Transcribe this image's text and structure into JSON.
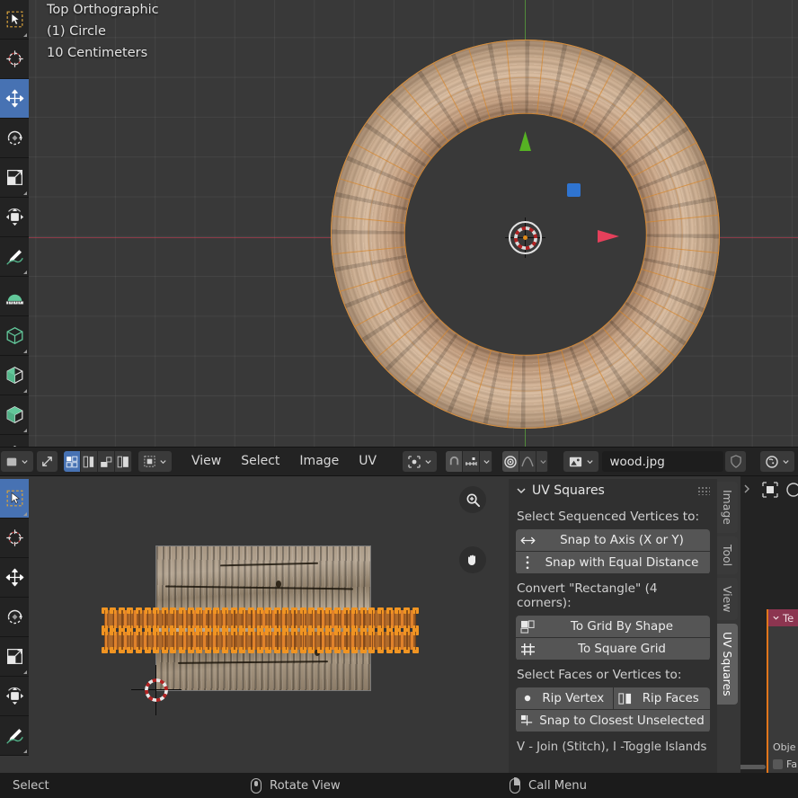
{
  "viewport": {
    "overlay_lines": [
      "Top Orthographic",
      "(1) Circle",
      "10 Centimeters"
    ],
    "view_name": "Top Orthographic",
    "object_name": "(1) Circle",
    "grid_scale": "10 Centimeters",
    "colors": {
      "x_axis": "#be3c50",
      "y_axis": "#5aaa3c",
      "select": "#dd8f36",
      "gizmo_blue": "#2f74d0"
    },
    "tools": [
      {
        "name": "tweak-select-box",
        "icon": "cursor-box-icon",
        "active": false
      },
      {
        "name": "cursor",
        "icon": "crosshair-icon",
        "active": false
      },
      {
        "name": "move",
        "icon": "move-arrows-icon",
        "active": true
      },
      {
        "name": "rotate",
        "icon": "rotate-icon",
        "active": false
      },
      {
        "name": "scale",
        "icon": "scale-icon",
        "active": false
      },
      {
        "name": "transform",
        "icon": "transform-icon",
        "active": false
      },
      {
        "name": "annotate",
        "icon": "pencil-icon",
        "active": false
      },
      {
        "name": "measure",
        "icon": "ruler-icon",
        "active": false
      },
      {
        "name": "add-cube",
        "icon": "cube-icon",
        "active": false
      },
      {
        "name": "extrude-region",
        "icon": "extrude-cube-icon",
        "active": false
      },
      {
        "name": "inset-faces",
        "icon": "inset-cube-icon",
        "active": false
      },
      {
        "name": "bevel",
        "icon": "bevel-icon",
        "active": false
      }
    ]
  },
  "uv_editor": {
    "editor_type": "UV Editor",
    "sync_selection_label": "UV Sync Selection",
    "select_modes": [
      {
        "name": "vertex",
        "active": true
      },
      {
        "name": "edge",
        "active": false
      },
      {
        "name": "face",
        "active": false
      },
      {
        "name": "island",
        "active": false
      }
    ],
    "sticky_mode": "sticky-selection-mode",
    "menus": [
      "View",
      "Select",
      "Image",
      "UV"
    ],
    "pivot_point": "pivot-point-dropdown",
    "snap_enabled": true,
    "snap_to": "snap-target-dropdown",
    "proportional_edit": true,
    "proportional_falloff": "smooth-falloff-dropdown",
    "image_browse_icon": "image-data-icon",
    "image_name": "wood.jpg",
    "fake_user_icon": "shield-icon",
    "display_mode": "image-display-dropdown",
    "tools": [
      {
        "name": "tweak-select-box",
        "icon": "cursor-box-icon",
        "active": true
      },
      {
        "name": "cursor",
        "icon": "crosshair-icon",
        "active": false
      },
      {
        "name": "move",
        "icon": "move-arrows-icon",
        "active": false
      },
      {
        "name": "rotate",
        "icon": "rotate-icon",
        "active": false
      },
      {
        "name": "scale",
        "icon": "scale-icon",
        "active": false
      },
      {
        "name": "transform",
        "icon": "transform-icon",
        "active": false
      },
      {
        "name": "annotate",
        "icon": "pencil-icon",
        "active": false
      }
    ],
    "nav": [
      {
        "name": "zoom",
        "icon": "magnifier-plus-icon"
      },
      {
        "name": "pan",
        "icon": "hand-icon"
      }
    ],
    "uv_islands": 2,
    "selected_color": "#f09422"
  },
  "side_panel": {
    "title": "UV Squares",
    "collapse_icon": "chevron-down-icon",
    "grip_icon": "grip-dots-icon",
    "sections": [
      {
        "label": "Select Sequenced Vertices to:",
        "buttons": [
          {
            "label": "Snap to Axis (X or Y)",
            "icon": "left-right-arrow-icon"
          },
          {
            "label": "Snap with Equal Distance",
            "icon": "vertical-dots-icon"
          }
        ]
      },
      {
        "label": "Convert \"Rectangle\" (4 corners):",
        "buttons": [
          {
            "label": "To Grid By Shape",
            "icon": "grid-shape-icon"
          },
          {
            "label": "To Square Grid",
            "icon": "square-grid-icon"
          }
        ]
      },
      {
        "label": "Select Faces or Vertices to:",
        "buttons": [
          {
            "label": "Rip Vertex",
            "icon": "dot-icon"
          },
          {
            "label": "Rip Faces",
            "icon": "split-faces-icon"
          },
          {
            "label": "Snap to Closest Unselected",
            "icon": "snap-closest-icon"
          }
        ]
      }
    ],
    "hint": "V - Join (Stitch), I -Toggle Islands",
    "tabs": [
      {
        "label": "Image",
        "active": false
      },
      {
        "label": "Tool",
        "active": false
      },
      {
        "label": "View",
        "active": false
      },
      {
        "label": "UV Squares",
        "active": true
      }
    ],
    "expand_icon": "chevron-right-icon"
  },
  "right_stub": {
    "toggle_icon": "chevron-right-icon",
    "frame_icon": "frame-square-icon",
    "panel_header": "Te",
    "panel_label": "Obje",
    "panel_sub": "Fa",
    "accent": "#e2761b",
    "header_color": "#8c3550"
  },
  "status_bar": {
    "items": [
      {
        "label": "Select",
        "mouse": "left"
      },
      {
        "label": "Rotate View",
        "mouse": "middle"
      },
      {
        "label": "Call Menu",
        "mouse": "right"
      }
    ]
  }
}
